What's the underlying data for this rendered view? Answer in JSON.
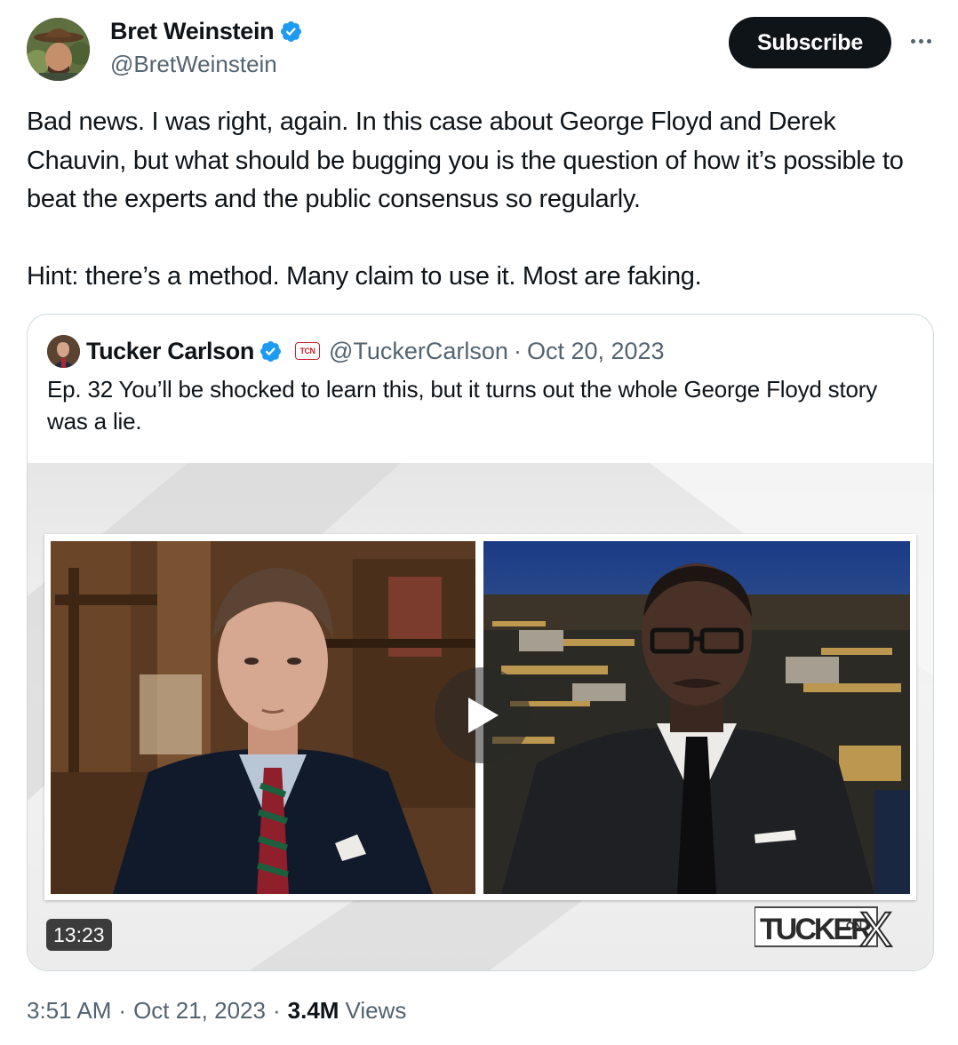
{
  "author": {
    "name": "Bret Weinstein",
    "handle": "@BretWeinstein",
    "verified": true
  },
  "header": {
    "subscribe_label": "Subscribe",
    "more_icon": "ellipsis-icon"
  },
  "tweet": {
    "paragraphs": [
      "Bad news. I was right, again. In this case about George Floyd and Derek Chauvin, but what should be bugging you is the question of how it’s possible to beat the experts and the public consensus so regularly.",
      "Hint: there’s a method. Many claim to use it. Most are faking."
    ]
  },
  "quote": {
    "name": "Tucker Carlson",
    "verified": true,
    "badge": "TCN",
    "handle": "@TuckerCarlson",
    "separator": "·",
    "date": "Oct 20, 2023",
    "text": "Ep. 32  You’ll be shocked to learn this, but it turns out the whole George Floyd story was a lie.",
    "video": {
      "duration": "13:23",
      "logo_text": "TUCKER",
      "logo_small": "ON",
      "logo_mark": "X"
    }
  },
  "footer": {
    "time": "3:51 AM",
    "sep1": "·",
    "date": "Oct 21, 2023",
    "sep2": "·",
    "views_count": "3.4M",
    "views_label": "Views"
  },
  "colors": {
    "verified_blue": "#1d9bf0",
    "secondary_text": "#536471",
    "primary_text": "#0f1419",
    "border": "#cfd9de"
  }
}
